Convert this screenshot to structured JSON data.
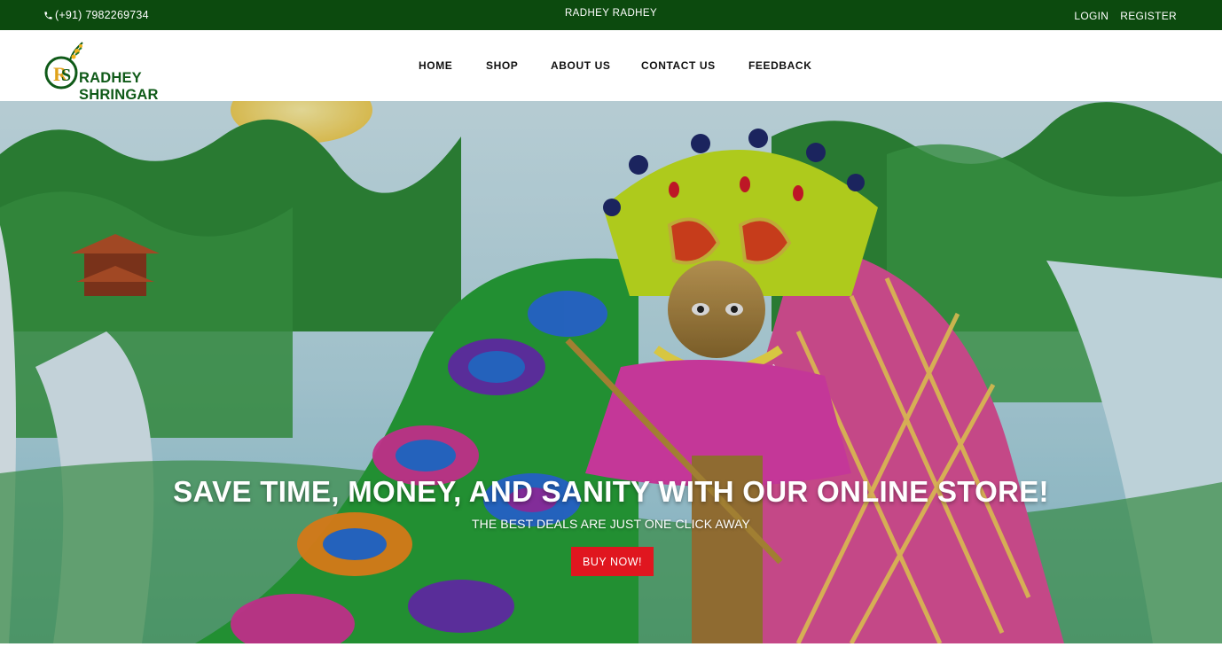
{
  "topbar": {
    "phone": "(+91) 7982269734",
    "phone_icon": "phone-icon",
    "center_text": "RADHEY RADHEY",
    "login": "LOGIN",
    "register": "REGISTER",
    "background": "#0c4a0e"
  },
  "header": {
    "brand": "RADHEY SHRINGAR",
    "nav": [
      "HOME",
      "SHOP",
      "ABOUT US",
      "CONTACT US",
      "FEEDBACK"
    ]
  },
  "hero": {
    "title": "SAVE TIME, MONEY, AND SANITY WITH OUR ONLINE STORE!",
    "subtitle": "THE BEST DEALS ARE JUST ONE CLICK AWAY",
    "cta": "BUY NOW!",
    "cta_color": "#e0161f"
  }
}
